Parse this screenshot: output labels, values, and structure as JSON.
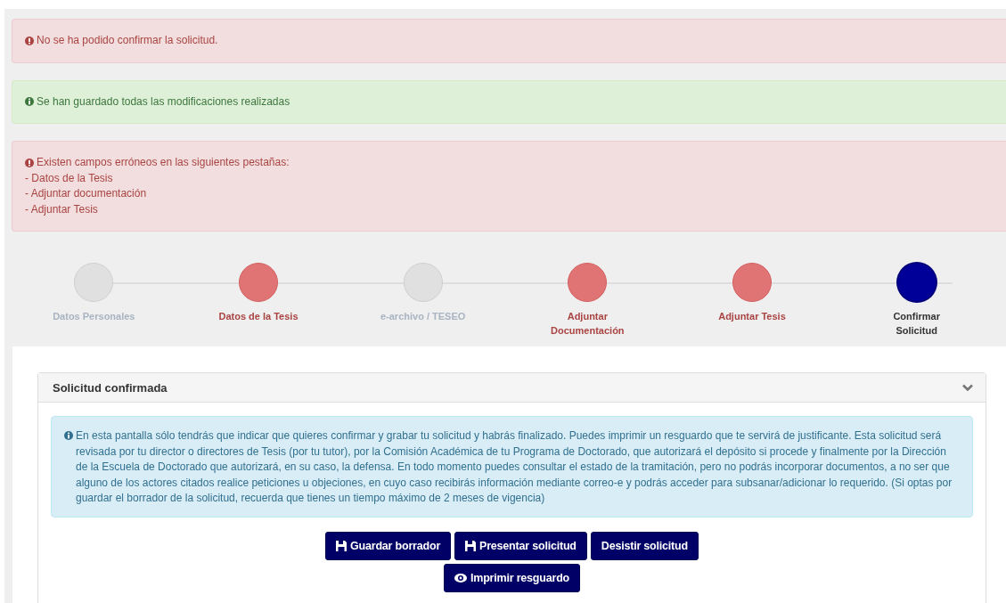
{
  "alerts": [
    {
      "kind": "error",
      "text": "No se ha podido confirmar la solicitud."
    },
    {
      "kind": "success",
      "text": "Se han guardado todas las modificaciones realizadas"
    },
    {
      "kind": "error",
      "text": "Existen campos erróneos en las siguientes pestañas:",
      "lines": [
        "- Datos de la Tesis",
        "- Adjuntar documentación",
        "- Adjuntar Tesis"
      ]
    }
  ],
  "steps": [
    {
      "label": "Datos Personales",
      "kind": "disabled",
      "selected": false
    },
    {
      "label": "Datos de la Tesis",
      "kind": "error",
      "selected": false
    },
    {
      "label": "e-archivo / TESEO",
      "kind": "disabled",
      "selected": false
    },
    {
      "label": "Adjuntar Documentación",
      "kind": "error",
      "selected": false
    },
    {
      "label": "Adjuntar Tesis",
      "kind": "error",
      "selected": false
    },
    {
      "label": "Confirmar Solicitud",
      "kind": "current",
      "selected": true
    }
  ],
  "panel": {
    "title": "Solicitud confirmada",
    "expanded": true,
    "info": "En esta pantalla sólo tendrás que indicar que quieres confirmar y grabar tu solicitud y habrás finalizado. Puedes imprimir un resguardo que te servirá de justificante. Esta solicitud será revisada por tu director o directores de Tesis (por tu tutor), por la Comisión Académica de tu Programa de Doctorado, que autorizará el depósito si procede y finalmente por la Dirección de la Escuela de Doctorado que autorizará, en su caso, la defensa. En todo momento puedes consultar el estado de la tramitación, pero no podrás incorporar documentos, a no ser que alguno de los actores citados realice peticiones u objeciones, en cuyo caso recibirás información mediante correo-e y podrás acceder para subsanar/adicionar lo requerido. (Si optas por guardar el borrador de la solicitud, recuerda que tienes un tiempo máximo de 2 meses de vigencia)",
    "buttons": [
      {
        "label": "Guardar borrador",
        "kind": "save"
      },
      {
        "label": "Presentar solicitud",
        "kind": "save"
      },
      {
        "label": "Desistir solicitud",
        "kind": "plain"
      },
      {
        "label": "Imprimir resguardo",
        "kind": "print"
      }
    ]
  }
}
